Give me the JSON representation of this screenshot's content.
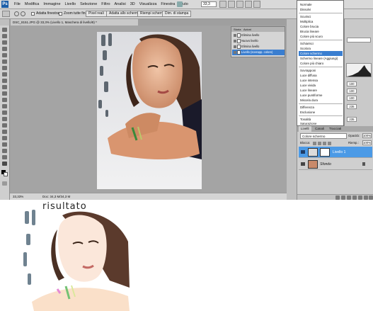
{
  "menubar": {
    "app_logo": "Ps",
    "items": [
      "File",
      "Modifica",
      "Immagine",
      "Livello",
      "Selezione",
      "Filtro",
      "Analisi",
      "3D",
      "Visualizza",
      "Finestra",
      "Aiuto"
    ],
    "zoom": "33,3"
  },
  "options_bar": {
    "resize_windows": "Adatta finestra",
    "zoom_all_windows": "Zoom tutte finestre",
    "actual_pixels": "Pixel reali",
    "fit_screen": "Adatta allo schermo",
    "fill_screen": "Riempi schermo",
    "print_size": "Dim. di stampa"
  },
  "document": {
    "tab_title": "DSC_8151.JPG @ 33,3% (Livello 1, Maschera di livello/8) *",
    "zoom": "33,33%",
    "doc_size": "Doc: 34,3 M/34,3 M"
  },
  "floating_panel": {
    "tabs": [
      "Storia",
      "Azioni"
    ],
    "rows": [
      "Elimina livello",
      "Nuovo livello",
      "Elimina livello",
      "Livello (sovrapp. colore)"
    ]
  },
  "blend_menu": {
    "items": [
      "Normale",
      "Dissolvi",
      "Scurisci",
      "Moltiplica",
      "Colore brucia",
      "Brucia lineare",
      "Colore più scuro",
      "Schiarisci",
      "Scolora",
      "Colore schermo",
      "Schermo lineare (Aggiungi)",
      "Colore più chiaro",
      "Sovrapponi",
      "Luce diffusa",
      "Luce intensa",
      "Luce vivida",
      "Luce lineare",
      "Luce puntiforme",
      "Miscela dura",
      "Differenza",
      "Esclusione",
      "Tonalità",
      "Saturazione",
      "Colore",
      "Luminosità"
    ],
    "selected": "Colore schermo"
  },
  "right_dock": {
    "fields": [
      "100",
      "100",
      "100",
      "235",
      "235"
    ]
  },
  "layers_panel": {
    "tabs": [
      "Livelli",
      "Canali",
      "Tracciati"
    ],
    "blend_mode": "Colore schermo",
    "opacity_label": "Opacità:",
    "opacity_value": "100%",
    "lock_label": "Blocca:",
    "fill_label": "Riemp.:",
    "fill_value": "100%",
    "layers": [
      {
        "name": "Livello 1",
        "selected": true
      },
      {
        "name": "Sfondo",
        "selected": false
      }
    ]
  },
  "result": {
    "title": "risultato"
  }
}
